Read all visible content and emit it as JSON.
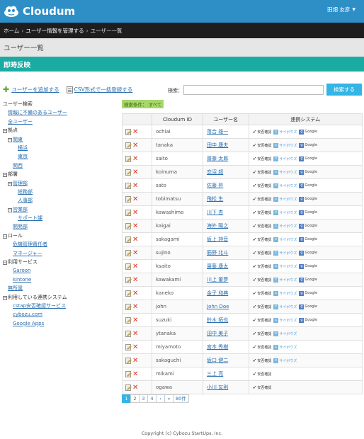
{
  "app": {
    "name": "Cloudum",
    "user": "田畑 友彦"
  },
  "breadcrumb": {
    "items": [
      "ホーム",
      "ユーザー情報を管理する",
      "ユーザー一覧"
    ]
  },
  "page": {
    "title": "ユーザー一覧",
    "banner": "即時反映"
  },
  "actions": {
    "add_user": "ユーザーを追加する",
    "csv": "CSV形式で一括登録する"
  },
  "search": {
    "label": "検索：",
    "value": "",
    "button": "検索する",
    "filter": "検索条件： すべて"
  },
  "tree": {
    "title": "ユーザー検索",
    "rows": [
      {
        "text": "情報に不備のあるユーザー",
        "link": true,
        "indent": 1,
        "toggle": ""
      },
      {
        "text": "全ユーザー",
        "link": true,
        "indent": 1,
        "toggle": ""
      },
      {
        "text": "拠点",
        "link": false,
        "indent": 0,
        "toggle": "−"
      },
      {
        "text": "関東",
        "link": true,
        "indent": 1,
        "toggle": "−"
      },
      {
        "text": "横浜",
        "link": true,
        "indent": 3,
        "toggle": ""
      },
      {
        "text": "東京",
        "link": true,
        "indent": 3,
        "toggle": ""
      },
      {
        "text": "関西",
        "link": true,
        "indent": 2,
        "toggle": ""
      },
      {
        "text": "部署",
        "link": false,
        "indent": 0,
        "toggle": "−"
      },
      {
        "text": "管理部",
        "link": true,
        "indent": 1,
        "toggle": "−"
      },
      {
        "text": "総務部",
        "link": true,
        "indent": 3,
        "toggle": ""
      },
      {
        "text": "人事部",
        "link": true,
        "indent": 3,
        "toggle": ""
      },
      {
        "text": "営業部",
        "link": true,
        "indent": 1,
        "toggle": "−"
      },
      {
        "text": "サポート課",
        "link": true,
        "indent": 3,
        "toggle": ""
      },
      {
        "text": "開発部",
        "link": true,
        "indent": 2,
        "toggle": ""
      },
      {
        "text": "ロール",
        "link": false,
        "indent": 0,
        "toggle": "−"
      },
      {
        "text": "危機管理責任者",
        "link": true,
        "indent": 2,
        "toggle": ""
      },
      {
        "text": "マネージャー",
        "link": true,
        "indent": 2,
        "toggle": ""
      },
      {
        "text": "利用サービス",
        "link": false,
        "indent": 0,
        "toggle": "−"
      },
      {
        "text": "Garoon",
        "link": true,
        "indent": 2,
        "toggle": ""
      },
      {
        "text": "kintone",
        "link": true,
        "indent": 2,
        "toggle": ""
      },
      {
        "text": "無所属",
        "link": true,
        "indent": 1,
        "toggle": ""
      },
      {
        "text": "利用している連携システム",
        "link": false,
        "indent": 0,
        "toggle": "−"
      },
      {
        "text": "cstap安否確認サービス",
        "link": true,
        "indent": 2,
        "toggle": ""
      },
      {
        "text": "cybozu.com",
        "link": true,
        "indent": 2,
        "toggle": ""
      },
      {
        "text": "Google Apps",
        "link": true,
        "indent": 2,
        "toggle": ""
      }
    ]
  },
  "table": {
    "headers": [
      "",
      "Cloudum ID",
      "ユーザー名",
      "連携システム"
    ],
    "service_labels": {
      "anpi": "安否確認",
      "cybozu": "サイボウズ",
      "google": "Google"
    },
    "rows": [
      {
        "id": "ochiai",
        "name": "落合 雄一",
        "services": [
          "anpi",
          "cybozu",
          "google"
        ]
      },
      {
        "id": "tanaka",
        "name": "田中 康夫",
        "services": [
          "anpi",
          "cybozu",
          "google"
        ]
      },
      {
        "id": "saito",
        "name": "齋藤 太郎",
        "services": [
          "anpi",
          "cybozu",
          "google"
        ]
      },
      {
        "id": "koinuma",
        "name": "恋沼 超",
        "services": [
          "anpi",
          "cybozu",
          "google"
        ]
      },
      {
        "id": "sato",
        "name": "佐藤 昇",
        "services": [
          "anpi",
          "cybozu",
          "google"
        ]
      },
      {
        "id": "tobimatsu",
        "name": "飛松 生",
        "services": [
          "anpi",
          "cybozu",
          "google"
        ]
      },
      {
        "id": "kawashimo",
        "name": "川下 杏",
        "services": [
          "anpi",
          "cybozu",
          "google"
        ]
      },
      {
        "id": "kaigai",
        "name": "海外 陽之",
        "services": [
          "anpi",
          "cybozu",
          "google"
        ]
      },
      {
        "id": "sakagami",
        "name": "坂上 詩音",
        "services": [
          "anpi",
          "cybozu",
          "google"
        ]
      },
      {
        "id": "sujino",
        "name": "筋野 北斗",
        "services": [
          "anpi",
          "cybozu",
          "google"
        ]
      },
      {
        "id": "ksaito",
        "name": "齋藤 康太",
        "services": [
          "anpi",
          "cybozu",
          "google"
        ]
      },
      {
        "id": "kawakami",
        "name": "川上 董夢",
        "services": [
          "anpi",
          "cybozu",
          "google"
        ]
      },
      {
        "id": "kaneko",
        "name": "金子 和典",
        "services": [
          "anpi",
          "cybozu",
          "google"
        ]
      },
      {
        "id": "john",
        "name": "John Doe",
        "services": [
          "anpi",
          "cybozu",
          "google"
        ]
      },
      {
        "id": "suzuki",
        "name": "鈴木 拓也",
        "services": [
          "anpi",
          "cybozu",
          "google"
        ]
      },
      {
        "id": "ytanaka",
        "name": "田中 美子",
        "services": [
          "anpi",
          "cybozu"
        ]
      },
      {
        "id": "miyamoto",
        "name": "宮本 秀樹",
        "services": [
          "anpi",
          "cybozu"
        ]
      },
      {
        "id": "sakaguchi",
        "name": "坂口 健二",
        "services": [
          "anpi",
          "cybozu"
        ]
      },
      {
        "id": "mikami",
        "name": "三上 亮",
        "services": [
          "anpi"
        ]
      },
      {
        "id": "ogawa",
        "name": "小川 友則",
        "services": [
          "anpi"
        ]
      }
    ]
  },
  "pagination": {
    "pages": [
      "1",
      "2",
      "3",
      "4",
      "›",
      "»",
      "80件"
    ],
    "active": "1"
  },
  "footer": {
    "text": "Copyright (c) Cybozu StartUps, Inc."
  },
  "colors": {
    "header": "#2e8fc7",
    "banner": "#1aaba3",
    "accent": "#33b5e5"
  }
}
